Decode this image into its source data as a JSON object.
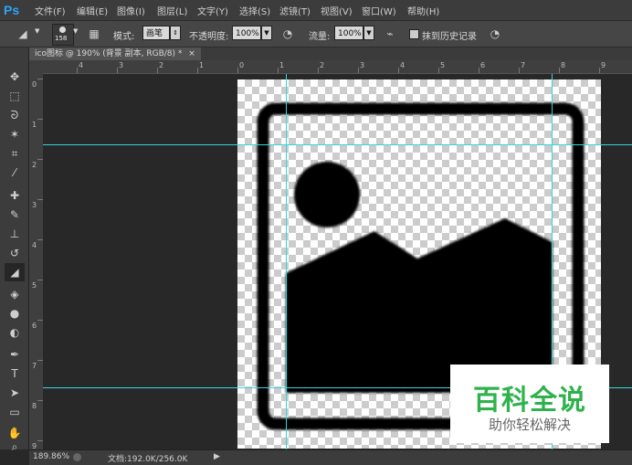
{
  "app": {
    "logo": "Ps"
  },
  "menu": [
    "文件(F)",
    "编辑(E)",
    "图像(I)",
    "图层(L)",
    "文字(Y)",
    "选择(S)",
    "滤镜(T)",
    "视图(V)",
    "窗口(W)",
    "帮助(H)"
  ],
  "options": {
    "brush_size": "158",
    "mode_label": "模式:",
    "mode_value": "画笔",
    "opacity_label": "不透明度:",
    "opacity_value": "100%",
    "flow_label": "流量:",
    "flow_value": "100%",
    "erase_history_label": "抹到历史记录"
  },
  "document": {
    "tab_title": "ico图标 @ 190% (背景 副本, RGB/8) *",
    "close": "×"
  },
  "rulers": {
    "top": [
      "4",
      "3",
      "2",
      "1",
      "0",
      "1",
      "2",
      "3",
      "4",
      "5",
      "6",
      "7",
      "8",
      "9"
    ],
    "left": [
      "0",
      "1",
      "2",
      "3",
      "4",
      "5",
      "6",
      "7",
      "8",
      "9"
    ]
  },
  "status": {
    "zoom": "189.86%",
    "doc_info": "文档:192.0K/256.0K",
    "arrow": "▶"
  },
  "watermark": {
    "title": "百科全说",
    "subtitle": "助你轻松解决"
  },
  "tools": [
    "move-icon",
    "marquee-icon",
    "lasso-icon",
    "magic-wand-icon",
    "crop-icon",
    "eyedropper-icon",
    "healing-brush-icon",
    "brush-icon",
    "clone-stamp-icon",
    "history-brush-icon",
    "eraser-icon",
    "paint-bucket-icon",
    "blur-icon",
    "dodge-icon",
    "pen-icon",
    "type-icon",
    "path-select-icon",
    "shape-icon",
    "hand-icon",
    "zoom-icon"
  ]
}
